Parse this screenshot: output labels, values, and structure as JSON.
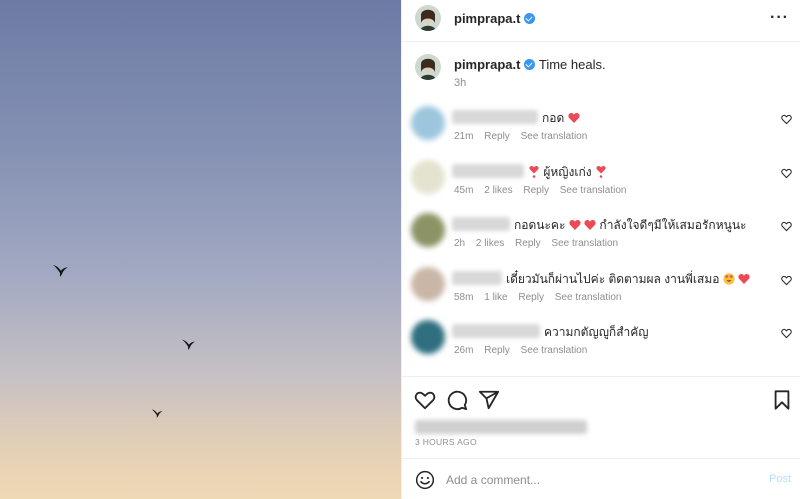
{
  "post": {
    "username": "pimprapa.t",
    "caption": "Time heals.",
    "time": "3h",
    "date": "3 HOURS AGO",
    "more_icon": "more-horizontal-icon",
    "add_comment_placeholder": "Add a comment...",
    "post_label": "Post"
  },
  "comments": [
    {
      "text": "กอด",
      "emoji_after": [
        "red-heart"
      ],
      "time": "21m",
      "likes": "",
      "reply": "Reply",
      "translate": "See translation"
    },
    {
      "text": "ผู้หญิงเก่ง",
      "emoji_before": [
        "heart-exclamation"
      ],
      "emoji_after": [
        "heart-exclamation"
      ],
      "time": "45m",
      "likes": "2 likes",
      "reply": "Reply",
      "translate": "See translation"
    },
    {
      "text_a": "กอดนะคะ",
      "text_b": "กำลังใจดีๆมีให้เสมอรักหนูนะ",
      "time": "2h",
      "likes": "2 likes",
      "reply": "Reply",
      "translate": "See translation"
    },
    {
      "text": "เดี๋ยวมันก็ผ่านไปค่ะ ติดตามผล งานพี่เสมอ",
      "emoji_after": [
        "heart-eyes",
        "red-heart"
      ],
      "time": "58m",
      "likes": "1 like",
      "reply": "Reply",
      "translate": "See translation"
    },
    {
      "text": "ความกตัญญูก็สำคัญ",
      "time": "26m",
      "likes": "",
      "reply": "Reply",
      "translate": "See translation"
    }
  ],
  "colors": {
    "verified": "#3897f0",
    "heart": "#ed4956",
    "post_disabled": "#b2dffc"
  }
}
